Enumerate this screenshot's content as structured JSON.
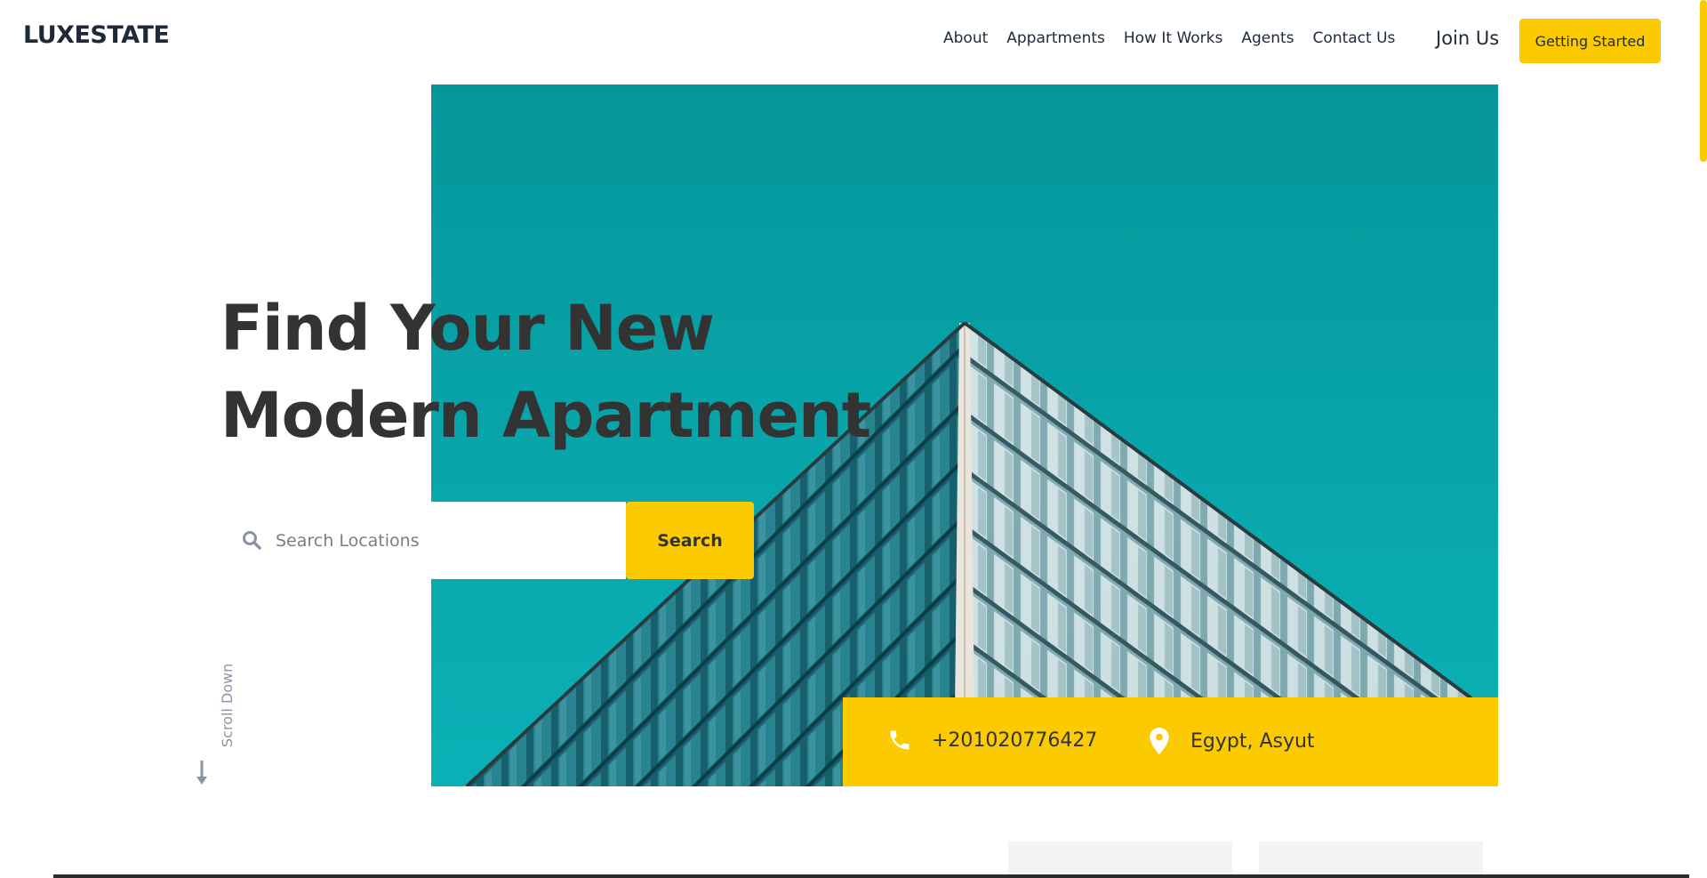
{
  "header": {
    "logo": "LUXESTATE",
    "nav": [
      "About",
      "Appartments",
      "How It Works",
      "Agents",
      "Contact Us"
    ],
    "join": "Join Us",
    "cta": "Getting Started"
  },
  "hero": {
    "headline_line1": "Find Your New",
    "headline_line2": "Modern Apartment",
    "search_placeholder": "Search Locations",
    "search_button": "Search",
    "scroll_label": "Scroll Down"
  },
  "contact": {
    "phone": "+201020776427",
    "location": "Egypt, Asyut"
  },
  "colors": {
    "accent": "#fcca00",
    "sky": "#08a6ab",
    "text": "#333333",
    "nav_text": "#1e2a38"
  },
  "icons": [
    "search-icon",
    "phone-icon",
    "location-pin-icon",
    "arrow-down-icon"
  ]
}
